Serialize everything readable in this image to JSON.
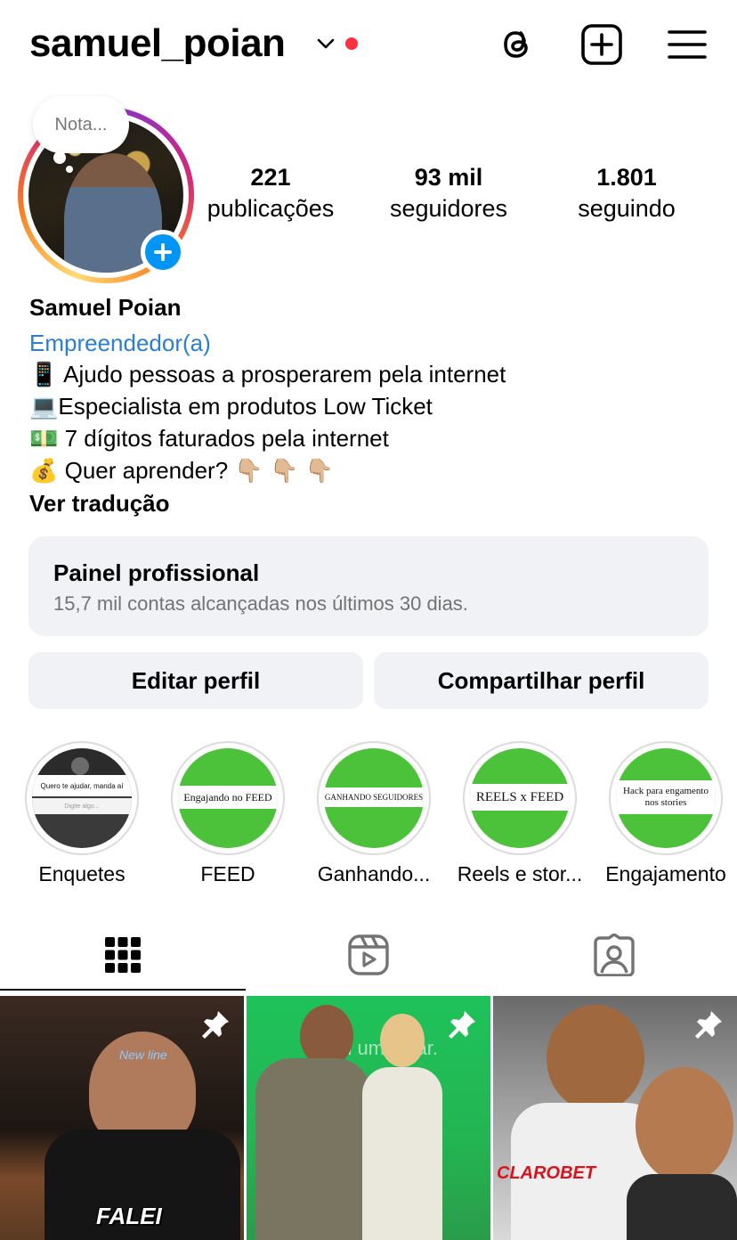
{
  "header": {
    "username": "samuel_poian",
    "icons": [
      "chevron-down-icon",
      "threads-icon",
      "create-post-icon",
      "menu-icon"
    ],
    "notification_color": "#ff3040"
  },
  "profile": {
    "note_placeholder": "Nota...",
    "stats": [
      {
        "value": "221",
        "label": "publicações"
      },
      {
        "value": "93 mil",
        "label": "seguidores"
      },
      {
        "value": "1.801",
        "label": "seguindo"
      }
    ],
    "full_name": "Samuel Poian",
    "category": "Empreendedor(a)",
    "bio_lines": [
      "📱  Ajudo pessoas a prosperarem pela internet",
      "💻Especialista em produtos Low Ticket",
      "💵  7 dígitos faturados pela internet",
      "💰 Quer aprender?  👇🏼 👇🏼 👇🏼"
    ],
    "translate_label": "Ver tradução"
  },
  "dashboard": {
    "title": "Painel profissional",
    "subtitle": "15,7 mil contas alcançadas nos últimos 30 dias."
  },
  "actions": {
    "edit_label": "Editar perfil",
    "share_label": "Compartilhar perfil"
  },
  "highlights": [
    {
      "label": "Enquetes",
      "cover_text": "Quero te ajudar, manda aí",
      "cover_sub": "Digite algo..."
    },
    {
      "label": "FEED",
      "cover_text": "Engajando no FEED"
    },
    {
      "label": "Ganhando...",
      "cover_text": "GANHANDO SEGUIDORES"
    },
    {
      "label": "Reels e stor...",
      "cover_text": "REELS x FEED"
    },
    {
      "label": "Engajamento",
      "cover_text": "Hack para engamento nos stories"
    }
  ],
  "tabs": [
    "grid-icon",
    "reels-icon",
    "tagged-icon"
  ],
  "posts": [
    {
      "pinned": true,
      "overlay_text": "FALEI",
      "caption_fragment": "New line"
    },
    {
      "pinned": true,
      "overlay_text": "m um lugar."
    },
    {
      "pinned": true,
      "overlay_text": "CLAROBET"
    }
  ],
  "colors": {
    "accent_blue": "#0095f6",
    "link_blue": "#2a7fd4",
    "panel_bg": "#f0f2f5",
    "highlight_green": "#4cc23a"
  }
}
